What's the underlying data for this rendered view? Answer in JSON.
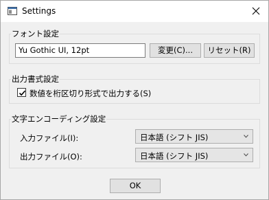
{
  "window": {
    "title": "Settings"
  },
  "font_group": {
    "legend": "フォント設定",
    "font_value": "Yu Gothic UI, 12pt",
    "change_label": "変更(C)...",
    "reset_label": "リセット(R)"
  },
  "output_group": {
    "legend": "出力書式設定",
    "checkbox_label": "数値を桁区切り形式で出力する(S)",
    "checkbox_checked": true
  },
  "encoding_group": {
    "legend": "文字エンコーディング設定",
    "input_label": "入力ファイル(I):",
    "input_value": "日本語 (シフト JIS)",
    "output_label": "出力ファイル(O):",
    "output_value": "日本語 (シフト JIS)"
  },
  "footer": {
    "ok_label": "OK"
  },
  "icons": {
    "app": "window-app-icon",
    "close": "close-icon",
    "check": "check-icon",
    "dropdown": "chevron-down-icon"
  }
}
